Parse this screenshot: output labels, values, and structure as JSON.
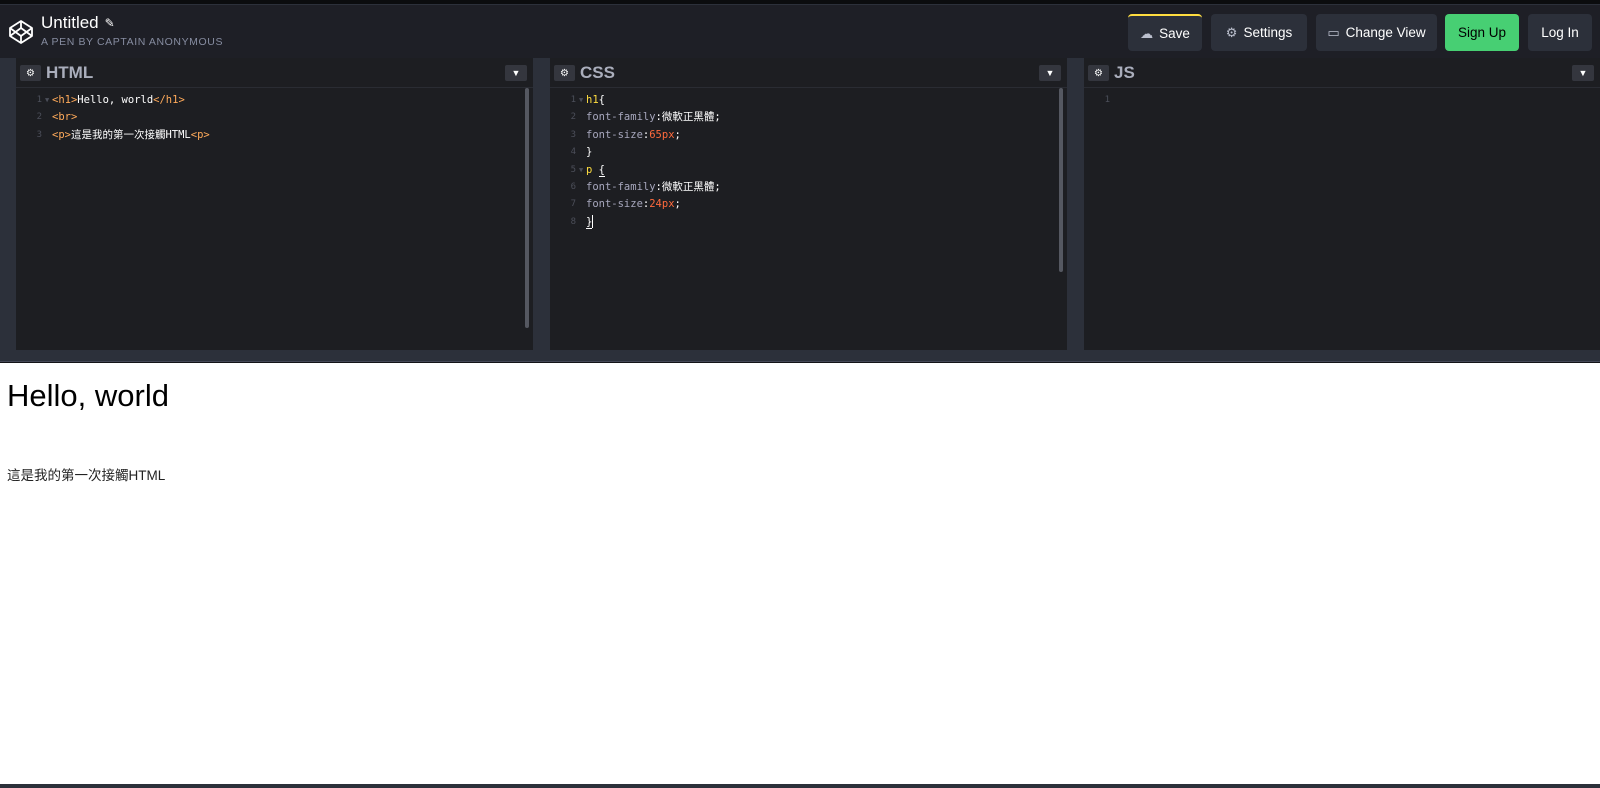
{
  "header": {
    "title": "Untitled",
    "subtitle": "A PEN BY CAPTAIN ANONYMOUS",
    "buttons": {
      "save": "Save",
      "settings": "Settings",
      "change_view": "Change View",
      "sign_up": "Sign Up",
      "log_in": "Log In"
    }
  },
  "editors": {
    "html": {
      "title": "HTML",
      "lines": [
        "1",
        "2",
        "3"
      ]
    },
    "css": {
      "title": "CSS",
      "lines": [
        "1",
        "2",
        "3",
        "4",
        "5",
        "6",
        "7",
        "8"
      ]
    },
    "js": {
      "title": "JS",
      "lines": [
        "1"
      ]
    }
  },
  "code_tokens": {
    "h1_open": "<h1>",
    "hello_world": "Hello, world",
    "h1_close": "</h1>",
    "br": "<br>",
    "p_open": "<p>",
    "p_text": "這是我的第一次接觸HTML",
    "p_close": "<p>",
    "css_h1_sel": "h1",
    "brace_open": "{",
    "brace_close": "}",
    "ff_prop": "font-family",
    "ff_val": "微軟正黑體",
    "fs_prop": "font-size",
    "fs_val_1": "65px",
    "fs_val_2": "24px",
    "css_p_sel": "p"
  },
  "preview": {
    "heading": "Hello, world",
    "paragraph": "這是我的第一次接觸HTML"
  },
  "colors": {
    "accent_save": "#ffdd40",
    "signup_green": "#47cf73",
    "tag_orange": "#ffaa5a",
    "number_orange": "#ff6a3d"
  }
}
